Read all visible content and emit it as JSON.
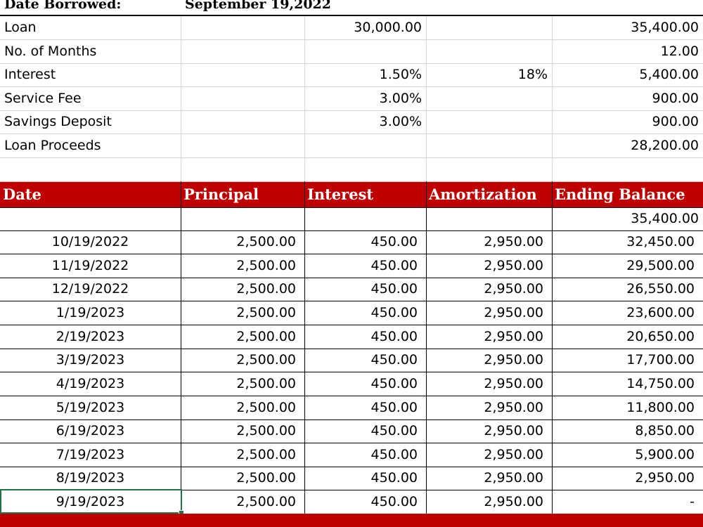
{
  "title_row": {
    "label": "Date Borrowed:",
    "value": "September 19,2022"
  },
  "summary": [
    {
      "label": "Loan",
      "c": "30,000.00",
      "d": "",
      "e": "35,400.00"
    },
    {
      "label": "No. of Months",
      "c": "",
      "d": "",
      "e": "12.00"
    },
    {
      "label": "Interest",
      "c": "1.50%",
      "d": "18%",
      "e": "5,400.00"
    },
    {
      "label": "Service Fee",
      "c": "3.00%",
      "d": "",
      "e": "900.00"
    },
    {
      "label": "Savings Deposit",
      "c": "3.00%",
      "d": "",
      "e": "900.00"
    },
    {
      "label": "Loan Proceeds",
      "c": "",
      "d": "",
      "e": "28,200.00"
    }
  ],
  "schedule": {
    "headers": [
      "Date",
      "Principal",
      "Interest",
      "Amortization",
      "Ending Balance"
    ],
    "opening_balance": "35,400.00",
    "rows": [
      [
        "10/19/2022",
        "2,500.00",
        "450.00",
        "2,950.00",
        "32,450.00"
      ],
      [
        "11/19/2022",
        "2,500.00",
        "450.00",
        "2,950.00",
        "29,500.00"
      ],
      [
        "12/19/2022",
        "2,500.00",
        "450.00",
        "2,950.00",
        "26,550.00"
      ],
      [
        "1/19/2023",
        "2,500.00",
        "450.00",
        "2,950.00",
        "23,600.00"
      ],
      [
        "2/19/2023",
        "2,500.00",
        "450.00",
        "2,950.00",
        "20,650.00"
      ],
      [
        "3/19/2023",
        "2,500.00",
        "450.00",
        "2,950.00",
        "17,700.00"
      ],
      [
        "4/19/2023",
        "2,500.00",
        "450.00",
        "2,950.00",
        "14,750.00"
      ],
      [
        "5/19/2023",
        "2,500.00",
        "450.00",
        "2,950.00",
        "11,800.00"
      ],
      [
        "6/19/2023",
        "2,500.00",
        "450.00",
        "2,950.00",
        "8,850.00"
      ],
      [
        "7/19/2023",
        "2,500.00",
        "450.00",
        "2,950.00",
        "5,900.00"
      ],
      [
        "8/19/2023",
        "2,500.00",
        "450.00",
        "2,950.00",
        "2,950.00"
      ],
      [
        "9/19/2023",
        "2,500.00",
        "450.00",
        "2,950.00",
        "-"
      ]
    ]
  },
  "colors": {
    "header_fill": "#C00000",
    "header_text": "#FFFFFF",
    "grid_light": "#D4D4D4",
    "border_dark": "#000000",
    "selection": "#217346"
  }
}
